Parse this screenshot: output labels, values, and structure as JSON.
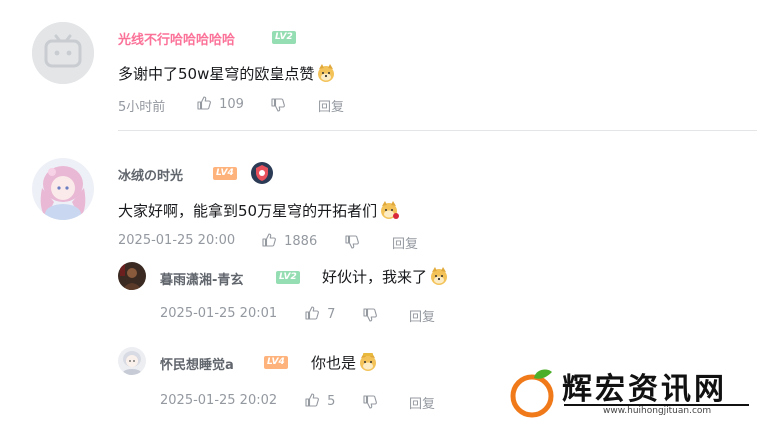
{
  "comments": [
    {
      "username": "光线不行哈哈哈哈哈",
      "username_color": "#fb7299",
      "level": "LV2",
      "level_color": "#95ddb2",
      "content": "多谢中了50w星穹的欧皇点赞",
      "emote": "doge-emote",
      "time": "5小时前",
      "likes": "109",
      "reply_label": "回复"
    },
    {
      "username": "冰绒の时光",
      "username_color": "#61666d",
      "level": "LV4",
      "level_color": "#ffb37c",
      "badge": "shield-badge",
      "content": "大家好啊，能拿到50万星穹的开拓者们",
      "emote": "doge-rose-emote",
      "time": "2025-01-25 20:00",
      "likes": "1886",
      "reply_label": "回复",
      "replies": [
        {
          "username": "暮雨潇湘-青玄",
          "level": "LV2",
          "level_color": "#95ddb2",
          "content": "好伙计，我来了",
          "emote": "doge-emote",
          "time": "2025-01-25 20:01",
          "likes": "7",
          "reply_label": "回复"
        },
        {
          "username": "怀民想睡觉a",
          "level": "LV4",
          "level_color": "#ffb37c",
          "content": "你也是",
          "emote": "doge-gold-emote",
          "time": "2025-01-25 20:02",
          "likes": "5",
          "reply_label": "回复"
        }
      ]
    }
  ],
  "watermark": {
    "text": "辉宏资讯网",
    "url": "www.huihongjituan.com"
  }
}
